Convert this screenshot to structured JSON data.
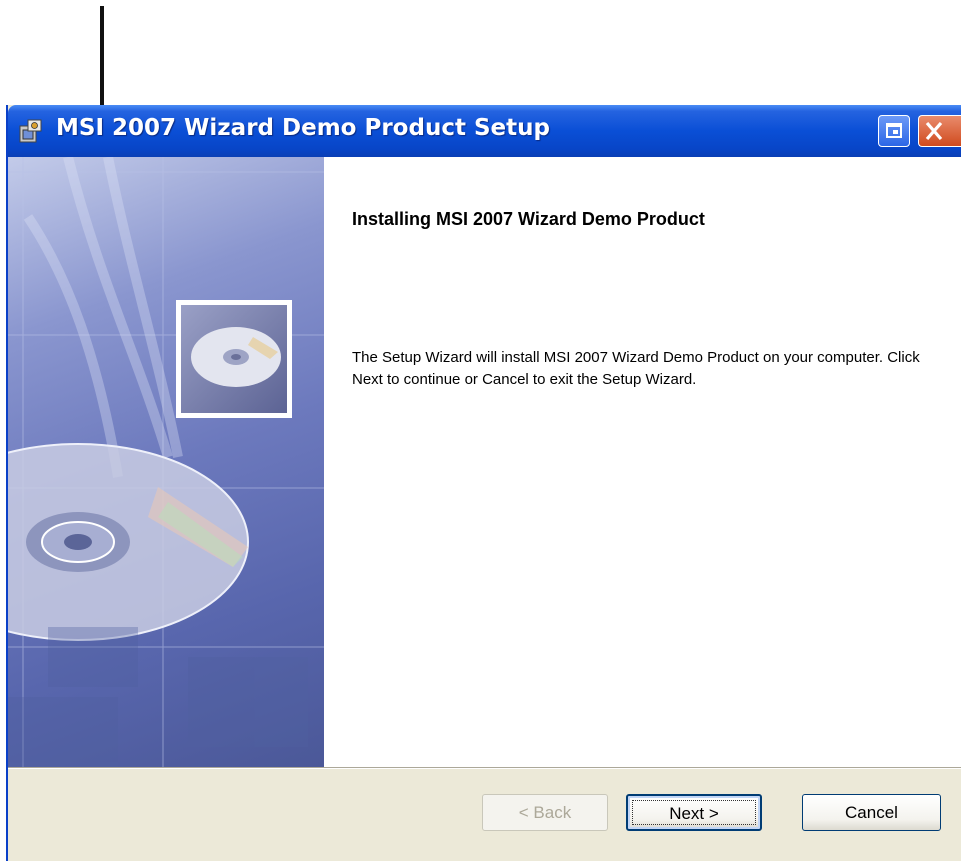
{
  "window": {
    "title": "MSI 2007 Wizard Demo Product Setup"
  },
  "content": {
    "heading": "Installing MSI 2007 Wizard Demo Product",
    "body": "The Setup Wizard will install MSI 2007 Wizard Demo Product on your computer.  Click Next to continue or Cancel to exit the Setup Wizard."
  },
  "buttons": {
    "back_label": "< Back",
    "next_label": "Next >",
    "cancel_label": "Cancel"
  },
  "icons": {
    "title_icon": "installer-icon",
    "restore": "restore-icon",
    "close": "close-icon",
    "annotation": "arrow-icon"
  },
  "colors": {
    "titlebar": "#0a4fd6",
    "face": "#ece9d8",
    "banner": "#6c79bd",
    "close_button": "#d04b1e"
  }
}
